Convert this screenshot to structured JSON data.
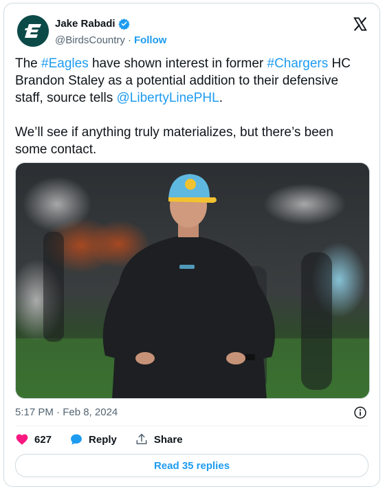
{
  "author": {
    "name": "Jake Rabadi",
    "handle": "@BirdsCountry",
    "separator": "·",
    "follow_label": "Follow",
    "avatar_icon": "birds-country-logo",
    "verified": true
  },
  "tweet": {
    "segments": [
      {
        "text": "The ",
        "type": "text"
      },
      {
        "text": "#Eagles",
        "type": "link"
      },
      {
        "text": " have shown interest in former ",
        "type": "text"
      },
      {
        "text": "#Chargers",
        "type": "link"
      },
      {
        "text": " HC Brandon Staley as a potential addition to their defensive staff, source tells ",
        "type": "text"
      },
      {
        "text": "@LibertyLinePHL",
        "type": "link"
      },
      {
        "text": ".\n\nWe’ll see if anything truly materializes, but there’s been some contact.",
        "type": "text"
      }
    ]
  },
  "media": {
    "caption_icon": "photo-brandon-staley"
  },
  "meta": {
    "timestamp": "5:17 PM · Feb 8, 2024"
  },
  "actions": {
    "like_count": "627",
    "reply_label": "Reply",
    "share_label": "Share"
  },
  "read_replies_label": "Read 35 replies",
  "colors": {
    "accent": "#1d9bf0",
    "like": "#f91880",
    "text": "#0f1419",
    "muted": "#536471"
  }
}
